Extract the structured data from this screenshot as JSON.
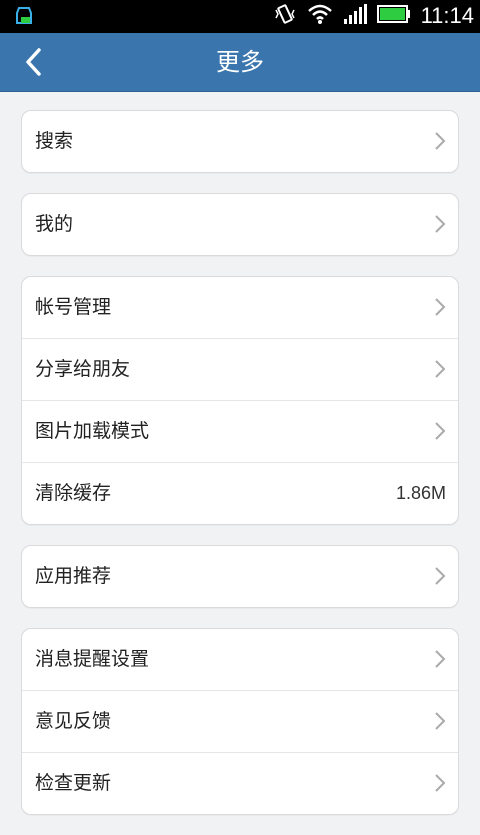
{
  "status_bar": {
    "time": "11:14"
  },
  "header": {
    "title": "更多"
  },
  "groups": [
    {
      "items": [
        {
          "label": "搜索"
        }
      ]
    },
    {
      "items": [
        {
          "label": "我的"
        }
      ]
    },
    {
      "items": [
        {
          "label": "帐号管理"
        },
        {
          "label": "分享给朋友"
        },
        {
          "label": "图片加载模式"
        },
        {
          "label": "清除缓存",
          "value": "1.86M"
        }
      ]
    },
    {
      "items": [
        {
          "label": "应用推荐"
        }
      ]
    },
    {
      "items": [
        {
          "label": "消息提醒设置"
        },
        {
          "label": "意见反馈"
        },
        {
          "label": "检查更新"
        }
      ]
    }
  ],
  "colors": {
    "accent": "#3a76ad",
    "background": "#f1f2f4"
  },
  "icons": [
    "app-notification-icon",
    "vibrate-icon",
    "wifi-icon",
    "signal-icon",
    "battery-icon",
    "back-icon",
    "chevron-right-icon"
  ]
}
